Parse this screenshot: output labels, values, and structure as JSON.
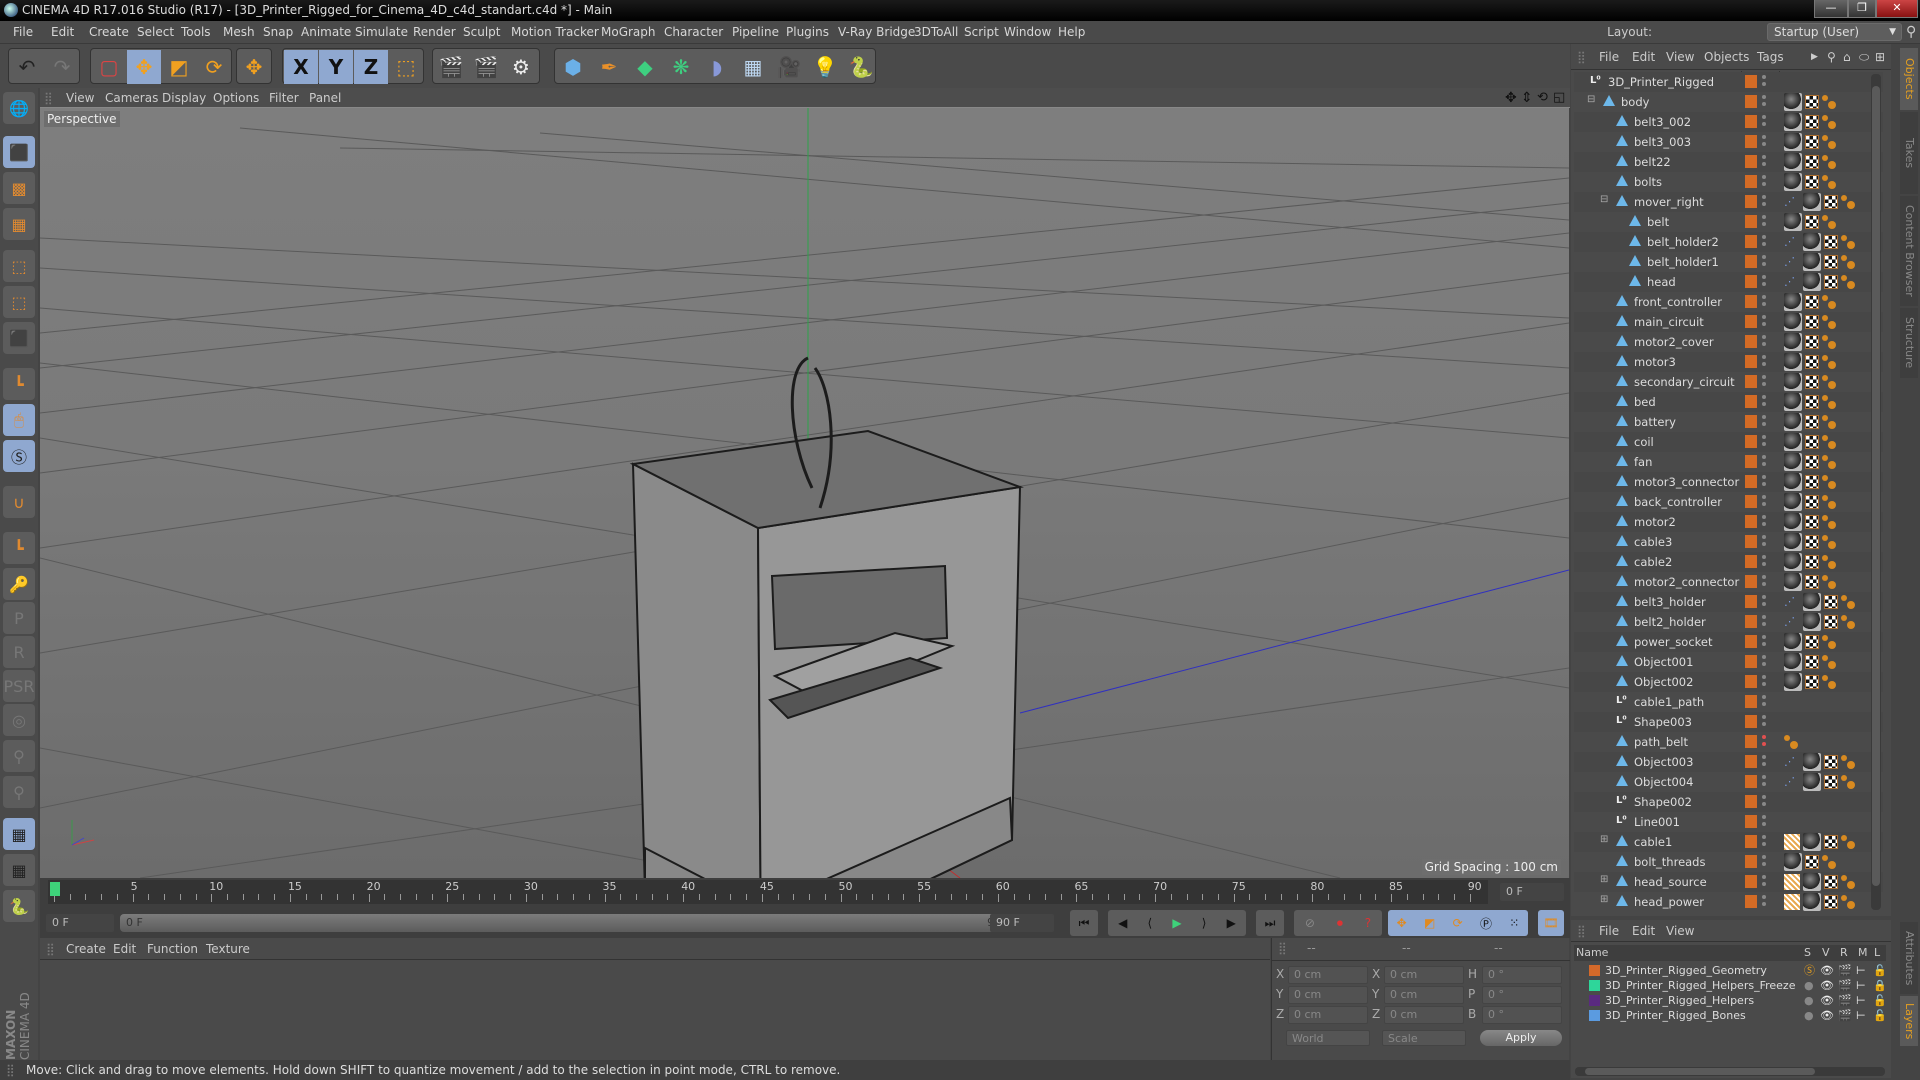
{
  "window": {
    "title": "CINEMA 4D R17.016 Studio (R17) - [3D_Printer_Rigged_for_Cinema_4D_c4d_standart.c4d *] - Main",
    "minimize": "—",
    "restore": "❐",
    "close": "✕"
  },
  "menubar": [
    "File",
    "Edit",
    "Create",
    "Select",
    "Tools",
    "Mesh",
    "Snap",
    "Animate",
    "Simulate",
    "Render",
    "Sculpt",
    "Motion Tracker",
    "MoGraph",
    "Character",
    "Pipeline",
    "Plugins",
    "V-Ray Bridge",
    "3DToAll",
    "Script",
    "Window",
    "Help"
  ],
  "layout": {
    "label": "Layout:",
    "value": "Startup (User)"
  },
  "toolbar": {
    "undo": "↶",
    "redo": "↷",
    "axes": [
      "X",
      "Y",
      "Z"
    ]
  },
  "viewport": {
    "menu": [
      "View",
      "Cameras",
      "Display",
      "Options",
      "Filter",
      "Panel"
    ],
    "camera_label": "Perspective",
    "grid_spacing": "Grid Spacing : 100 cm",
    "nav_icons": [
      "move-view-icon",
      "dolly-view-icon",
      "rotate-view-icon",
      "maximize-view-icon"
    ]
  },
  "timeline": {
    "ticks": [
      0,
      5,
      10,
      15,
      20,
      25,
      30,
      35,
      40,
      45,
      50,
      55,
      60,
      65,
      70,
      75,
      80,
      85,
      90
    ],
    "current_frame": "0 F",
    "start_field": "0 F",
    "slider_start": "0 F",
    "slider_end": "90 F",
    "end_field": "90 F",
    "right_field": "0 F"
  },
  "materials": {
    "menu": [
      "Create",
      "Edit",
      "Function",
      "Texture"
    ]
  },
  "coords": {
    "headers": [
      "--",
      "--",
      "--"
    ],
    "rows": [
      {
        "l1": "X",
        "v1": "0 cm",
        "l2": "X",
        "v2": "0 cm",
        "l3": "H",
        "v3": "0 °"
      },
      {
        "l1": "Y",
        "v1": "0 cm",
        "l2": "Y",
        "v2": "0 cm",
        "l3": "P",
        "v3": "0 °"
      },
      {
        "l1": "Z",
        "v1": "0 cm",
        "l2": "Z",
        "v2": "0 cm",
        "l3": "B",
        "v3": "0 °"
      }
    ],
    "mode": "World",
    "type": "Scale",
    "apply": "Apply"
  },
  "status": "Move: Click and drag to move elements. Hold down SHIFT to quantize movement / add to the selection in point mode, CTRL to remove.",
  "brand": {
    "maxon": "MAXON",
    "product": "CINEMA 4D"
  },
  "object_manager": {
    "menu": [
      "File",
      "Edit",
      "View",
      "Objects",
      "Tags"
    ],
    "objects": [
      {
        "name": "3D_Printer_Rigged",
        "depth": 0,
        "type": "null",
        "expand": "",
        "tags": []
      },
      {
        "name": "body",
        "depth": 1,
        "type": "poly",
        "expand": "-",
        "tags": [
          "mat",
          "uv",
          "ph"
        ]
      },
      {
        "name": "belt3_002",
        "depth": 2,
        "type": "poly",
        "expand": "",
        "tags": [
          "mat",
          "uv",
          "ph"
        ]
      },
      {
        "name": "belt3_003",
        "depth": 2,
        "type": "poly",
        "expand": "",
        "tags": [
          "mat",
          "uv",
          "ph"
        ]
      },
      {
        "name": "belt22",
        "depth": 2,
        "type": "poly",
        "expand": "",
        "tags": [
          "mat",
          "uv",
          "ph"
        ]
      },
      {
        "name": "bolts",
        "depth": 2,
        "type": "poly",
        "expand": "",
        "tags": [
          "mat",
          "uv",
          "ph"
        ]
      },
      {
        "name": "mover_right",
        "depth": 2,
        "type": "poly",
        "expand": "-",
        "tags": [
          "sel",
          "mat",
          "uv",
          "ph"
        ]
      },
      {
        "name": "belt",
        "depth": 3,
        "type": "poly",
        "expand": "",
        "tags": [
          "mat",
          "uv",
          "ph"
        ]
      },
      {
        "name": "belt_holder2",
        "depth": 3,
        "type": "poly",
        "expand": "",
        "tags": [
          "sel",
          "mat",
          "uv",
          "ph"
        ]
      },
      {
        "name": "belt_holder1",
        "depth": 3,
        "type": "poly",
        "expand": "",
        "tags": [
          "sel",
          "mat",
          "uv",
          "ph"
        ]
      },
      {
        "name": "head",
        "depth": 3,
        "type": "poly",
        "expand": "",
        "tags": [
          "sel",
          "mat",
          "uv",
          "ph"
        ]
      },
      {
        "name": "front_controller",
        "depth": 2,
        "type": "poly",
        "expand": "",
        "tags": [
          "mat",
          "uv",
          "ph"
        ]
      },
      {
        "name": "main_circuit",
        "depth": 2,
        "type": "poly",
        "expand": "",
        "tags": [
          "mat",
          "uv",
          "ph"
        ]
      },
      {
        "name": "motor2_cover",
        "depth": 2,
        "type": "poly",
        "expand": "",
        "tags": [
          "mat",
          "uv",
          "ph"
        ]
      },
      {
        "name": "motor3",
        "depth": 2,
        "type": "poly",
        "expand": "",
        "tags": [
          "mat",
          "uv",
          "ph"
        ]
      },
      {
        "name": "secondary_circuit",
        "depth": 2,
        "type": "poly",
        "expand": "",
        "tags": [
          "mat",
          "uv",
          "ph"
        ]
      },
      {
        "name": "bed",
        "depth": 2,
        "type": "poly",
        "expand": "",
        "tags": [
          "mat",
          "uv",
          "ph"
        ]
      },
      {
        "name": "battery",
        "depth": 2,
        "type": "poly",
        "expand": "",
        "tags": [
          "mat",
          "uv",
          "ph"
        ]
      },
      {
        "name": "coil",
        "depth": 2,
        "type": "poly",
        "expand": "",
        "tags": [
          "mat",
          "uv",
          "ph"
        ]
      },
      {
        "name": "fan",
        "depth": 2,
        "type": "poly",
        "expand": "",
        "tags": [
          "mat",
          "uv",
          "ph"
        ]
      },
      {
        "name": "motor3_connector",
        "depth": 2,
        "type": "poly",
        "expand": "",
        "tags": [
          "mat",
          "uv",
          "ph"
        ]
      },
      {
        "name": "back_controller",
        "depth": 2,
        "type": "poly",
        "expand": "",
        "tags": [
          "mat",
          "uv",
          "ph"
        ]
      },
      {
        "name": "motor2",
        "depth": 2,
        "type": "poly",
        "expand": "",
        "tags": [
          "mat",
          "uv",
          "ph"
        ]
      },
      {
        "name": "cable3",
        "depth": 2,
        "type": "poly",
        "expand": "",
        "tags": [
          "mat",
          "uv",
          "ph"
        ]
      },
      {
        "name": "cable2",
        "depth": 2,
        "type": "poly",
        "expand": "",
        "tags": [
          "mat",
          "uv",
          "ph"
        ]
      },
      {
        "name": "motor2_connector",
        "depth": 2,
        "type": "poly",
        "expand": "",
        "tags": [
          "mat",
          "uv",
          "ph"
        ]
      },
      {
        "name": "belt3_holder",
        "depth": 2,
        "type": "poly",
        "expand": "",
        "tags": [
          "sel",
          "mat",
          "uv",
          "ph"
        ]
      },
      {
        "name": "belt2_holder",
        "depth": 2,
        "type": "poly",
        "expand": "",
        "tags": [
          "sel",
          "mat",
          "uv",
          "ph"
        ]
      },
      {
        "name": "power_socket",
        "depth": 2,
        "type": "poly",
        "expand": "",
        "tags": [
          "mat",
          "uv",
          "ph"
        ]
      },
      {
        "name": "Object001",
        "depth": 2,
        "type": "poly",
        "expand": "",
        "tags": [
          "mat",
          "uv",
          "ph"
        ]
      },
      {
        "name": "Object002",
        "depth": 2,
        "type": "poly",
        "expand": "",
        "tags": [
          "mat",
          "uv",
          "ph"
        ]
      },
      {
        "name": "cable1_path",
        "depth": 2,
        "type": "null",
        "expand": "",
        "tags": []
      },
      {
        "name": "Shape003",
        "depth": 2,
        "type": "null",
        "expand": "",
        "tags": []
      },
      {
        "name": "path_belt",
        "depth": 2,
        "type": "poly",
        "expand": "",
        "tags": [
          "ph"
        ],
        "red_dots": true
      },
      {
        "name": "Object003",
        "depth": 2,
        "type": "poly",
        "expand": "",
        "tags": [
          "sel",
          "mat",
          "uv",
          "ph"
        ]
      },
      {
        "name": "Object004",
        "depth": 2,
        "type": "poly",
        "expand": "",
        "tags": [
          "sel",
          "mat",
          "uv",
          "ph"
        ]
      },
      {
        "name": "Shape002",
        "depth": 2,
        "type": "null",
        "expand": "",
        "tags": []
      },
      {
        "name": "Line001",
        "depth": 2,
        "type": "null",
        "expand": "",
        "tags": []
      },
      {
        "name": "cable1",
        "depth": 2,
        "type": "poly",
        "expand": "+",
        "tags": [
          "hair",
          "mat",
          "uv",
          "ph"
        ]
      },
      {
        "name": "bolt_threads",
        "depth": 2,
        "type": "poly",
        "expand": "",
        "tags": [
          "mat",
          "uv",
          "ph"
        ]
      },
      {
        "name": "head_source",
        "depth": 2,
        "type": "poly",
        "expand": "+",
        "tags": [
          "hair",
          "mat",
          "uv",
          "ph"
        ]
      },
      {
        "name": "head_power",
        "depth": 2,
        "type": "poly",
        "expand": "+",
        "tags": [
          "hair",
          "mat",
          "uv",
          "ph"
        ]
      }
    ]
  },
  "side_tabs_top": [
    "Objects",
    "Takes",
    "Content Browser",
    "Structure"
  ],
  "side_tabs_bottom": [
    "Attributes",
    "Layers"
  ],
  "layer_manager": {
    "menu": [
      "File",
      "Edit",
      "View"
    ],
    "columns": [
      "Name",
      "S",
      "V",
      "R",
      "M",
      "L"
    ],
    "layers": [
      {
        "name": "3D_Printer_Rigged_Geometry",
        "color": "#d4692a",
        "solo": true,
        "locked": false
      },
      {
        "name": "3D_Printer_Rigged_Helpers_Freeze",
        "color": "#2ed69a",
        "solo": false,
        "locked": true
      },
      {
        "name": "3D_Printer_Rigged_Helpers",
        "color": "#5a2a80",
        "solo": false,
        "locked": false
      },
      {
        "name": "3D_Printer_Rigged_Bones",
        "color": "#5b9be0",
        "solo": false,
        "locked": false
      }
    ]
  },
  "colors": {
    "accent_orange": "#e6a020",
    "active_blue": "#8fa8d0",
    "layer_orange": "#d46b25"
  }
}
